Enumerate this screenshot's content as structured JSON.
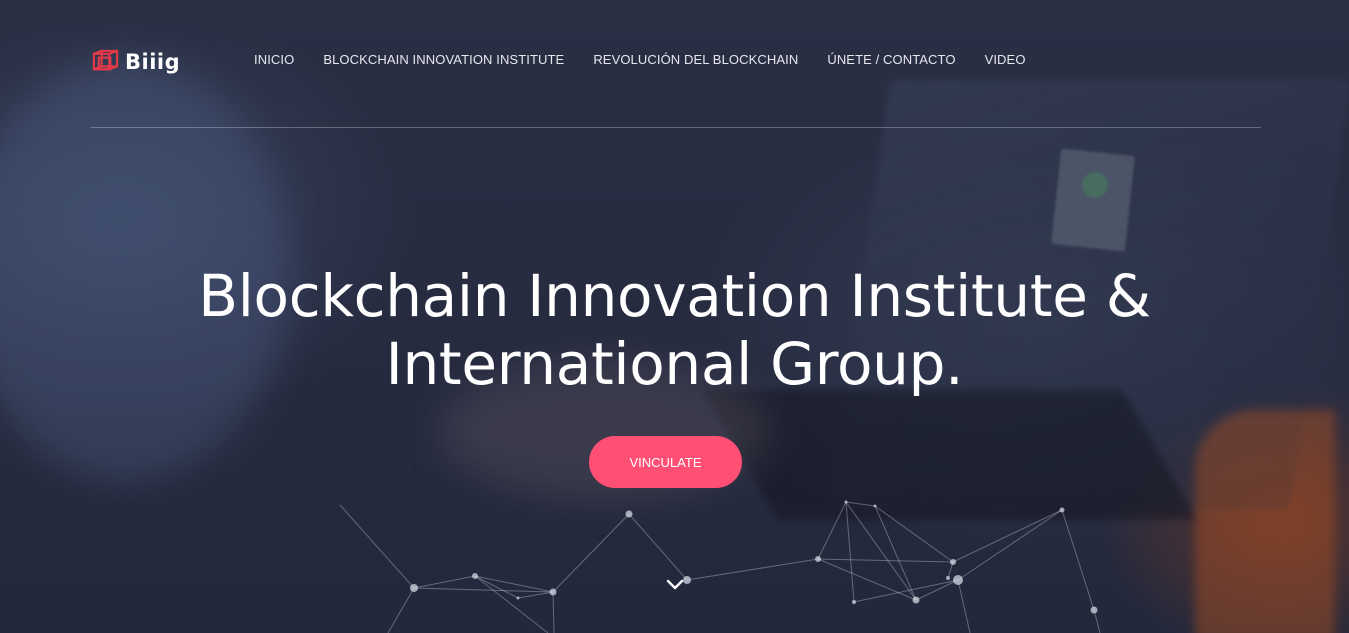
{
  "logo": {
    "text": "Biiig",
    "icon": "cube-logo-icon",
    "color": "#e53946"
  },
  "nav": {
    "items": [
      {
        "label": "INICIO"
      },
      {
        "label": "BLOCKCHAIN INNOVATION INSTITUTE"
      },
      {
        "label": "REVOLUCIÓN DEL BLOCKCHAIN"
      },
      {
        "label": "ÚNETE / CONTACTO"
      },
      {
        "label": "VIDEO"
      }
    ]
  },
  "hero": {
    "title_line1": "Blockchain Innovation Institute &",
    "title_line2": "International Group.",
    "cta_label": "VINCULATE",
    "cta_color": "#ff4f74",
    "scroll_icon": "chevron-down-icon"
  }
}
